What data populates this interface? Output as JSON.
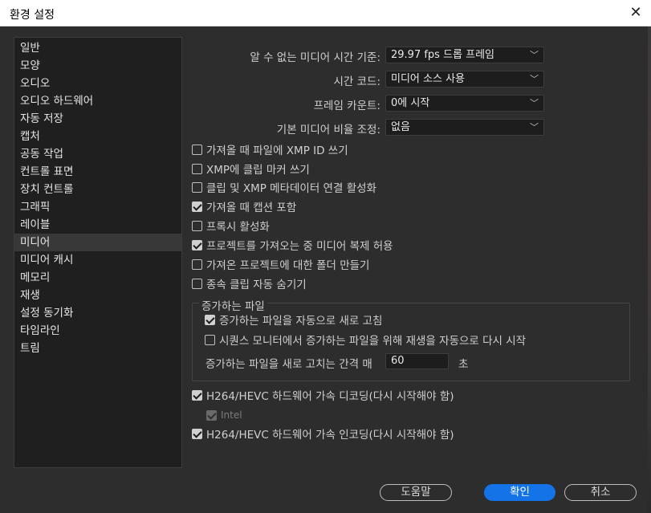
{
  "window": {
    "title": "환경 설정"
  },
  "sidebar": {
    "items": [
      {
        "label": "일반"
      },
      {
        "label": "모양"
      },
      {
        "label": "오디오"
      },
      {
        "label": "오디오 하드웨어"
      },
      {
        "label": "자동 저장"
      },
      {
        "label": "캡처"
      },
      {
        "label": "공동 작업"
      },
      {
        "label": "컨트롤 표면"
      },
      {
        "label": "장치 컨트롤"
      },
      {
        "label": "그래픽"
      },
      {
        "label": "레이블"
      },
      {
        "label": "미디어"
      },
      {
        "label": "미디어 캐시"
      },
      {
        "label": "메모리"
      },
      {
        "label": "재생"
      },
      {
        "label": "설정 동기화"
      },
      {
        "label": "타임라인"
      },
      {
        "label": "트림"
      }
    ],
    "selected": "미디어"
  },
  "settings": {
    "timebase": {
      "label": "알 수 없는 미디어 시간 기준:",
      "value": "29.97 fps 드롭 프레임"
    },
    "timecode": {
      "label": "시간 코드:",
      "value": "미디어 소스 사용"
    },
    "frame_count": {
      "label": "프레임 카운트:",
      "value": "0에 시작"
    },
    "scaling": {
      "label": "기본 미디어 비율 조정:",
      "value": "없음"
    }
  },
  "checks": {
    "write_xmp": {
      "label": "가져올 때 파일에 XMP ID 쓰기",
      "checked": false
    },
    "clip_markers": {
      "label": "XMP에 클립 마커 쓰기",
      "checked": false
    },
    "metadata_link": {
      "label": "클립 및 XMP 메타데이터 연결 활성화",
      "checked": false
    },
    "captions": {
      "label": "가져올 때 캡션 포함",
      "checked": true
    },
    "proxy": {
      "label": "프록시 활성화",
      "checked": false
    },
    "duplicate": {
      "label": "프로젝트를 가져오는 중 미디어 복제 허용",
      "checked": true
    },
    "bins": {
      "label": "가져온 프로젝트에 대한 폴더 만들기",
      "checked": false
    },
    "hide_sub": {
      "label": "종속 클립 자동 숨기기",
      "checked": false
    }
  },
  "growing": {
    "title": "증가하는 파일",
    "auto_refresh": {
      "label": "증가하는 파일을 자동으로 새로 고침",
      "checked": true
    },
    "restart": {
      "label": "시퀀스 모니터에서 증가하는 파일을 위해 재생을 자동으로 다시 시작",
      "checked": false
    },
    "interval_label": "증가하는 파일을 새로 고치는 간격 매",
    "interval_value": "60",
    "interval_unit": "초"
  },
  "hardware": {
    "decode": {
      "label": "H264/HEVC 하드웨어 가속 디코딩(다시 시작해야 함)",
      "checked": true
    },
    "intel": {
      "label": "Intel",
      "checked": true,
      "disabled": true
    },
    "encode": {
      "label": "H264/HEVC 하드웨어 가속 인코딩(다시 시작해야 함)",
      "checked": true
    }
  },
  "buttons": {
    "help": "도움말",
    "ok": "확인",
    "cancel": "취소"
  },
  "colors": {
    "accent": "#1473e6",
    "background": "#2d2d2d",
    "panel": "#1f1f1f"
  }
}
